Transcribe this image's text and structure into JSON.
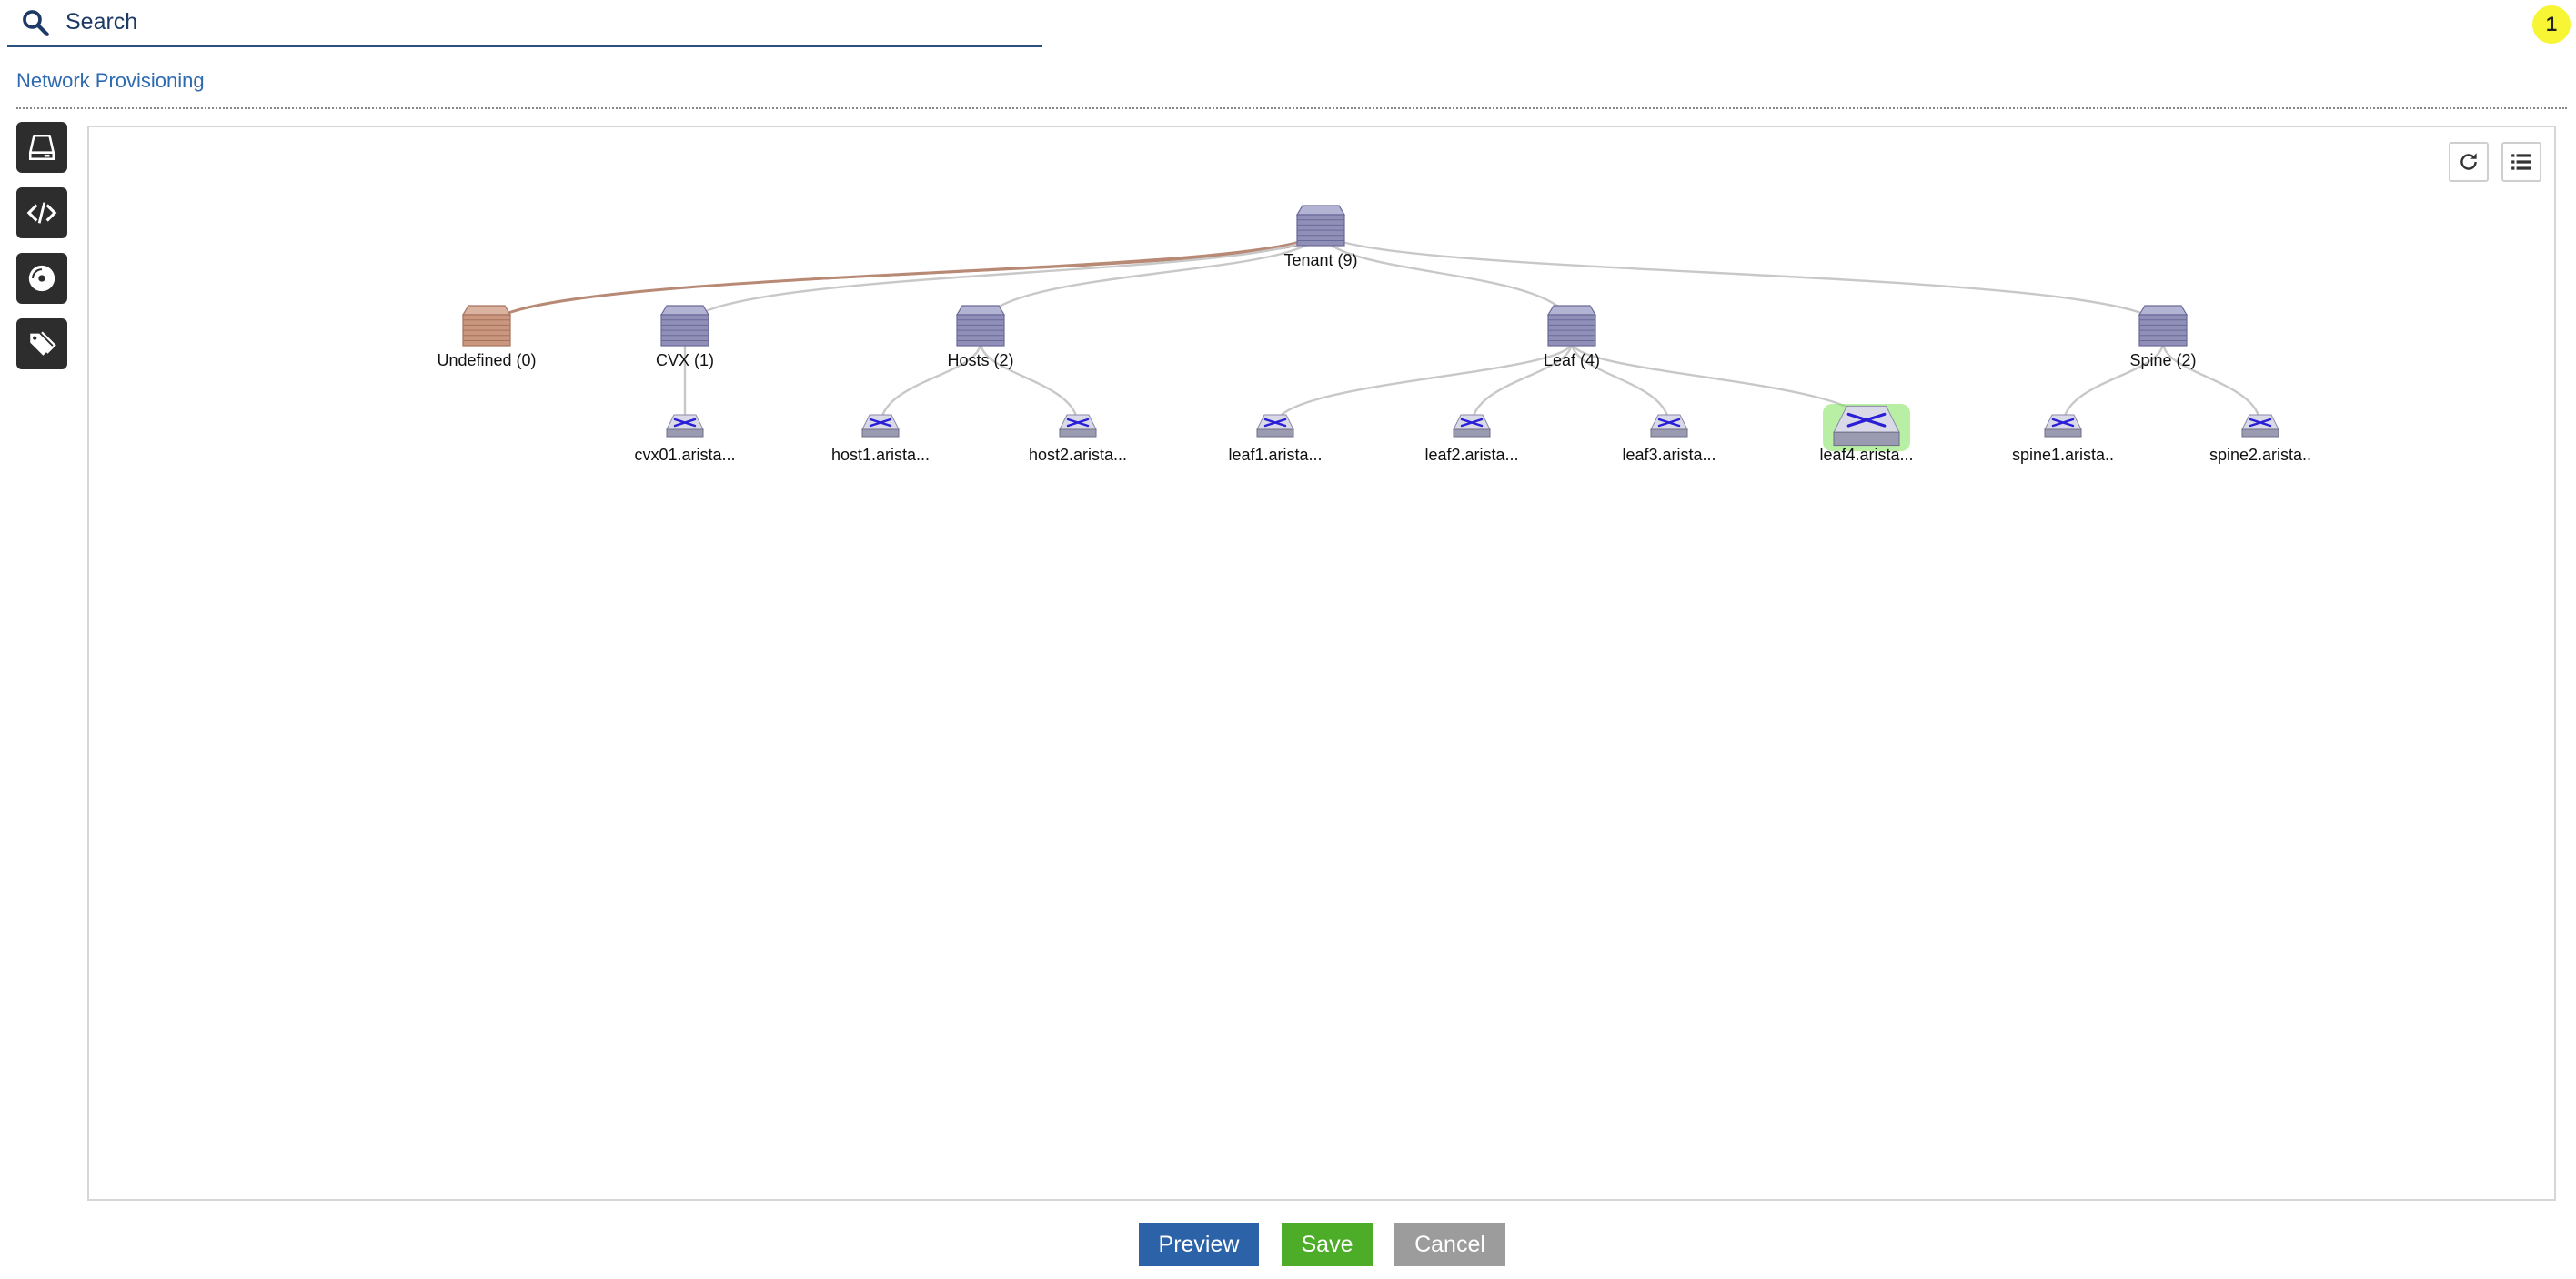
{
  "search": {
    "label": "Search"
  },
  "notification": {
    "count": "1"
  },
  "page": {
    "title": "Network Provisioning"
  },
  "tools": [
    {
      "name": "device-tool",
      "icon": "drive-tray-icon"
    },
    {
      "name": "code-tool",
      "icon": "code-icon"
    },
    {
      "name": "image-tool",
      "icon": "disc-icon"
    },
    {
      "name": "label-tool",
      "icon": "tags-icon"
    }
  ],
  "canvas_controls": {
    "refresh_icon": "refresh-icon",
    "list_icon": "list-icon"
  },
  "topology": {
    "root": {
      "id": "tenant",
      "label": "Tenant (9)"
    },
    "containers": [
      {
        "id": "undefined",
        "label": "Undefined (0)",
        "status": "empty"
      },
      {
        "id": "cvx",
        "label": "CVX (1)"
      },
      {
        "id": "hosts",
        "label": "Hosts (2)"
      },
      {
        "id": "leaf",
        "label": "Leaf (4)"
      },
      {
        "id": "spine",
        "label": "Spine (2)"
      }
    ],
    "devices": [
      {
        "id": "cvx01",
        "label": "cvx01.arista...",
        "parent": "cvx"
      },
      {
        "id": "host1",
        "label": "host1.arista...",
        "parent": "hosts"
      },
      {
        "id": "host2",
        "label": "host2.arista...",
        "parent": "hosts"
      },
      {
        "id": "leaf1",
        "label": "leaf1.arista...",
        "parent": "leaf"
      },
      {
        "id": "leaf2",
        "label": "leaf2.arista...",
        "parent": "leaf"
      },
      {
        "id": "leaf3",
        "label": "leaf3.arista...",
        "parent": "leaf"
      },
      {
        "id": "leaf4",
        "label": "leaf4.arista...",
        "parent": "leaf",
        "highlighted": true
      },
      {
        "id": "spine1",
        "label": "spine1.arista..",
        "parent": "spine"
      },
      {
        "id": "spine2",
        "label": "spine2.arista..",
        "parent": "spine"
      }
    ]
  },
  "footer": {
    "preview": "Preview",
    "save": "Save",
    "cancel": "Cancel"
  },
  "colors": {
    "container": "#8f8fb8",
    "container_empty": "#c9967e",
    "link": "#c8c8c8",
    "link_empty": "#b88a76",
    "highlight": "#7ee25a",
    "save": "#4dac28",
    "preview": "#2c62a8",
    "cancel": "#9c9c9c"
  }
}
